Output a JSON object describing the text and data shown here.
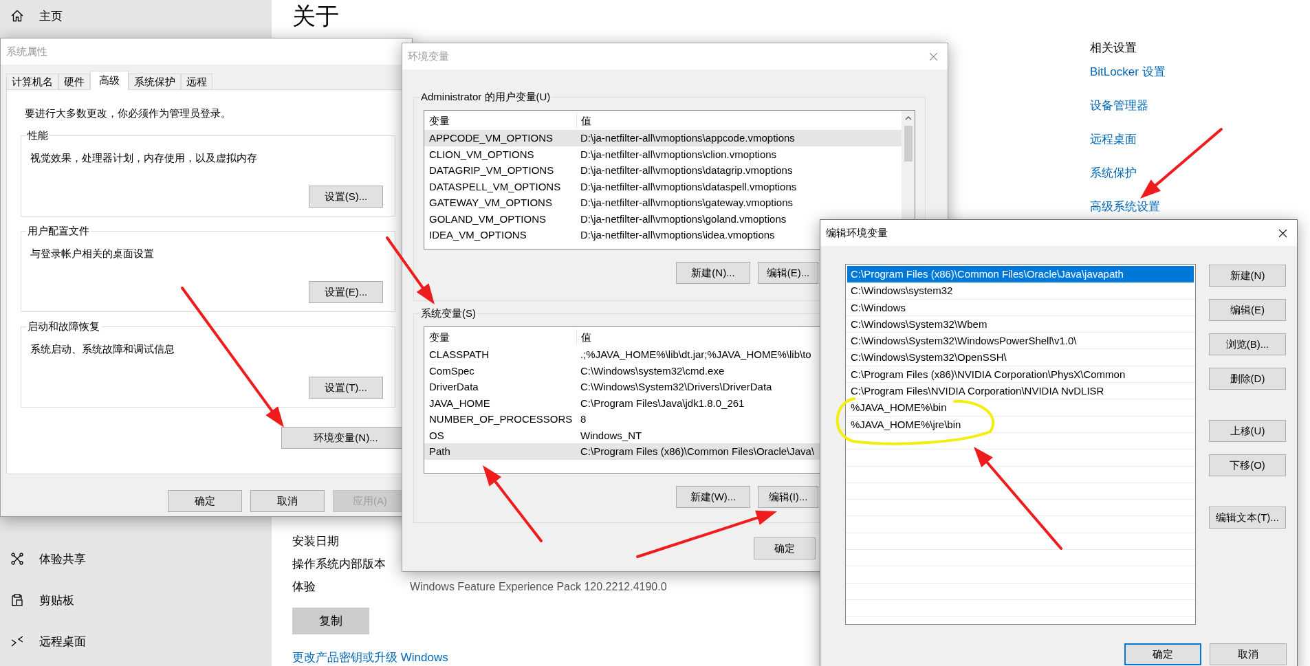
{
  "settings": {
    "sidebar": {
      "home": "主页",
      "items": [
        {
          "label": "体验共享",
          "kind": "share"
        },
        {
          "label": "剪贴板",
          "kind": "clipboard"
        },
        {
          "label": "远程桌面",
          "kind": "remote"
        }
      ]
    },
    "page_title": "关于",
    "specs": [
      {
        "label": "安装日期"
      },
      {
        "label": "操作系统内部版本"
      },
      {
        "label": "体验",
        "value": "Windows Feature Experience Pack 120.2212.4190.0"
      }
    ],
    "copy_button": "复制",
    "upgrade_link": "更改产品密钥或升级 Windows",
    "related": {
      "title": "相关设置",
      "links": [
        "BitLocker 设置",
        "设备管理器",
        "远程桌面",
        "系统保护",
        "高级系统设置"
      ]
    }
  },
  "system_properties": {
    "title": "系统属性",
    "tabs": [
      {
        "label": "计算机名",
        "selected": false
      },
      {
        "label": "硬件",
        "selected": false
      },
      {
        "label": "高级",
        "selected": true
      },
      {
        "label": "系统保护",
        "selected": false
      },
      {
        "label": "远程",
        "selected": false
      }
    ],
    "notice": "要进行大多数更改，你必须作为管理员登录。",
    "groups": [
      {
        "title": "性能",
        "description": "视觉效果，处理器计划，内存使用，以及虚拟内存",
        "button": "设置(S)..."
      },
      {
        "title": "用户配置文件",
        "description": "与登录帐户相关的桌面设置",
        "button": "设置(E)..."
      },
      {
        "title": "启动和故障恢复",
        "description": "系统启动、系统故障和调试信息",
        "button": "设置(T)..."
      }
    ],
    "env_button": "环境变量(N)...",
    "buttons": [
      {
        "label": "确定",
        "disabled": false
      },
      {
        "label": "取消",
        "disabled": false
      },
      {
        "label": "应用(A)",
        "disabled": true
      }
    ]
  },
  "environment_variables": {
    "title": "环境变量",
    "user_section": {
      "title": "Administrator 的用户变量(U)",
      "columns": [
        "变量",
        "值"
      ],
      "rows": [
        {
          "name": "APPCODE_VM_OPTIONS",
          "value": "D:\\ja-netfilter-all\\vmoptions\\appcode.vmoptions",
          "selected": true
        },
        {
          "name": "CLION_VM_OPTIONS",
          "value": "D:\\ja-netfilter-all\\vmoptions\\clion.vmoptions",
          "selected": false
        },
        {
          "name": "DATAGRIP_VM_OPTIONS",
          "value": "D:\\ja-netfilter-all\\vmoptions\\datagrip.vmoptions",
          "selected": false
        },
        {
          "name": "DATASPELL_VM_OPTIONS",
          "value": "D:\\ja-netfilter-all\\vmoptions\\dataspell.vmoptions",
          "selected": false
        },
        {
          "name": "GATEWAY_VM_OPTIONS",
          "value": "D:\\ja-netfilter-all\\vmoptions\\gateway.vmoptions",
          "selected": false
        },
        {
          "name": "GOLAND_VM_OPTIONS",
          "value": "D:\\ja-netfilter-all\\vmoptions\\goland.vmoptions",
          "selected": false
        },
        {
          "name": "IDEA_VM_OPTIONS",
          "value": "D:\\ja-netfilter-all\\vmoptions\\idea.vmoptions",
          "selected": false
        }
      ],
      "buttons": [
        "新建(N)...",
        "编辑(E)..."
      ]
    },
    "system_section": {
      "title": "系统变量(S)",
      "columns": [
        "变量",
        "值"
      ],
      "rows": [
        {
          "name": "CLASSPATH",
          "value": ".;%JAVA_HOME%\\lib\\dt.jar;%JAVA_HOME%\\lib\\to",
          "selected": false
        },
        {
          "name": "ComSpec",
          "value": "C:\\Windows\\system32\\cmd.exe",
          "selected": false
        },
        {
          "name": "DriverData",
          "value": "C:\\Windows\\System32\\Drivers\\DriverData",
          "selected": false
        },
        {
          "name": "JAVA_HOME",
          "value": "C:\\Program Files\\Java\\jdk1.8.0_261",
          "selected": false
        },
        {
          "name": "NUMBER_OF_PROCESSORS",
          "value": "8",
          "selected": false
        },
        {
          "name": "OS",
          "value": "Windows_NT",
          "selected": false
        },
        {
          "name": "Path",
          "value": "C:\\Program Files (x86)\\Common Files\\Oracle\\Java\\",
          "selected": true
        }
      ],
      "buttons": [
        "新建(W)...",
        "编辑(I)..."
      ]
    },
    "buttons": [
      "确定"
    ]
  },
  "edit_dialog": {
    "title": "编辑环境变量",
    "entries": [
      {
        "text": "C:\\Program Files (x86)\\Common Files\\Oracle\\Java\\javapath",
        "selected": true
      },
      {
        "text": "C:\\Windows\\system32",
        "selected": false
      },
      {
        "text": "C:\\Windows",
        "selected": false
      },
      {
        "text": "C:\\Windows\\System32\\Wbem",
        "selected": false
      },
      {
        "text": "C:\\Windows\\System32\\WindowsPowerShell\\v1.0\\",
        "selected": false
      },
      {
        "text": "C:\\Windows\\System32\\OpenSSH\\",
        "selected": false
      },
      {
        "text": "C:\\Program Files (x86)\\NVIDIA Corporation\\PhysX\\Common",
        "selected": false
      },
      {
        "text": "C:\\Program Files\\NVIDIA Corporation\\NVIDIA NvDLISR",
        "selected": false
      },
      {
        "text": "%JAVA_HOME%\\bin",
        "selected": false
      },
      {
        "text": "%JAVA_HOME%\\jre\\bin",
        "selected": false
      }
    ],
    "button_groups": [
      [
        "新建(N)",
        "编辑(E)",
        "浏览(B)...",
        "删除(D)"
      ],
      [
        "上移(U)",
        "下移(O)"
      ],
      [
        "编辑文本(T)..."
      ]
    ],
    "footer_buttons": [
      {
        "label": "确定",
        "default": true
      },
      {
        "label": "取消",
        "default": false
      }
    ]
  }
}
